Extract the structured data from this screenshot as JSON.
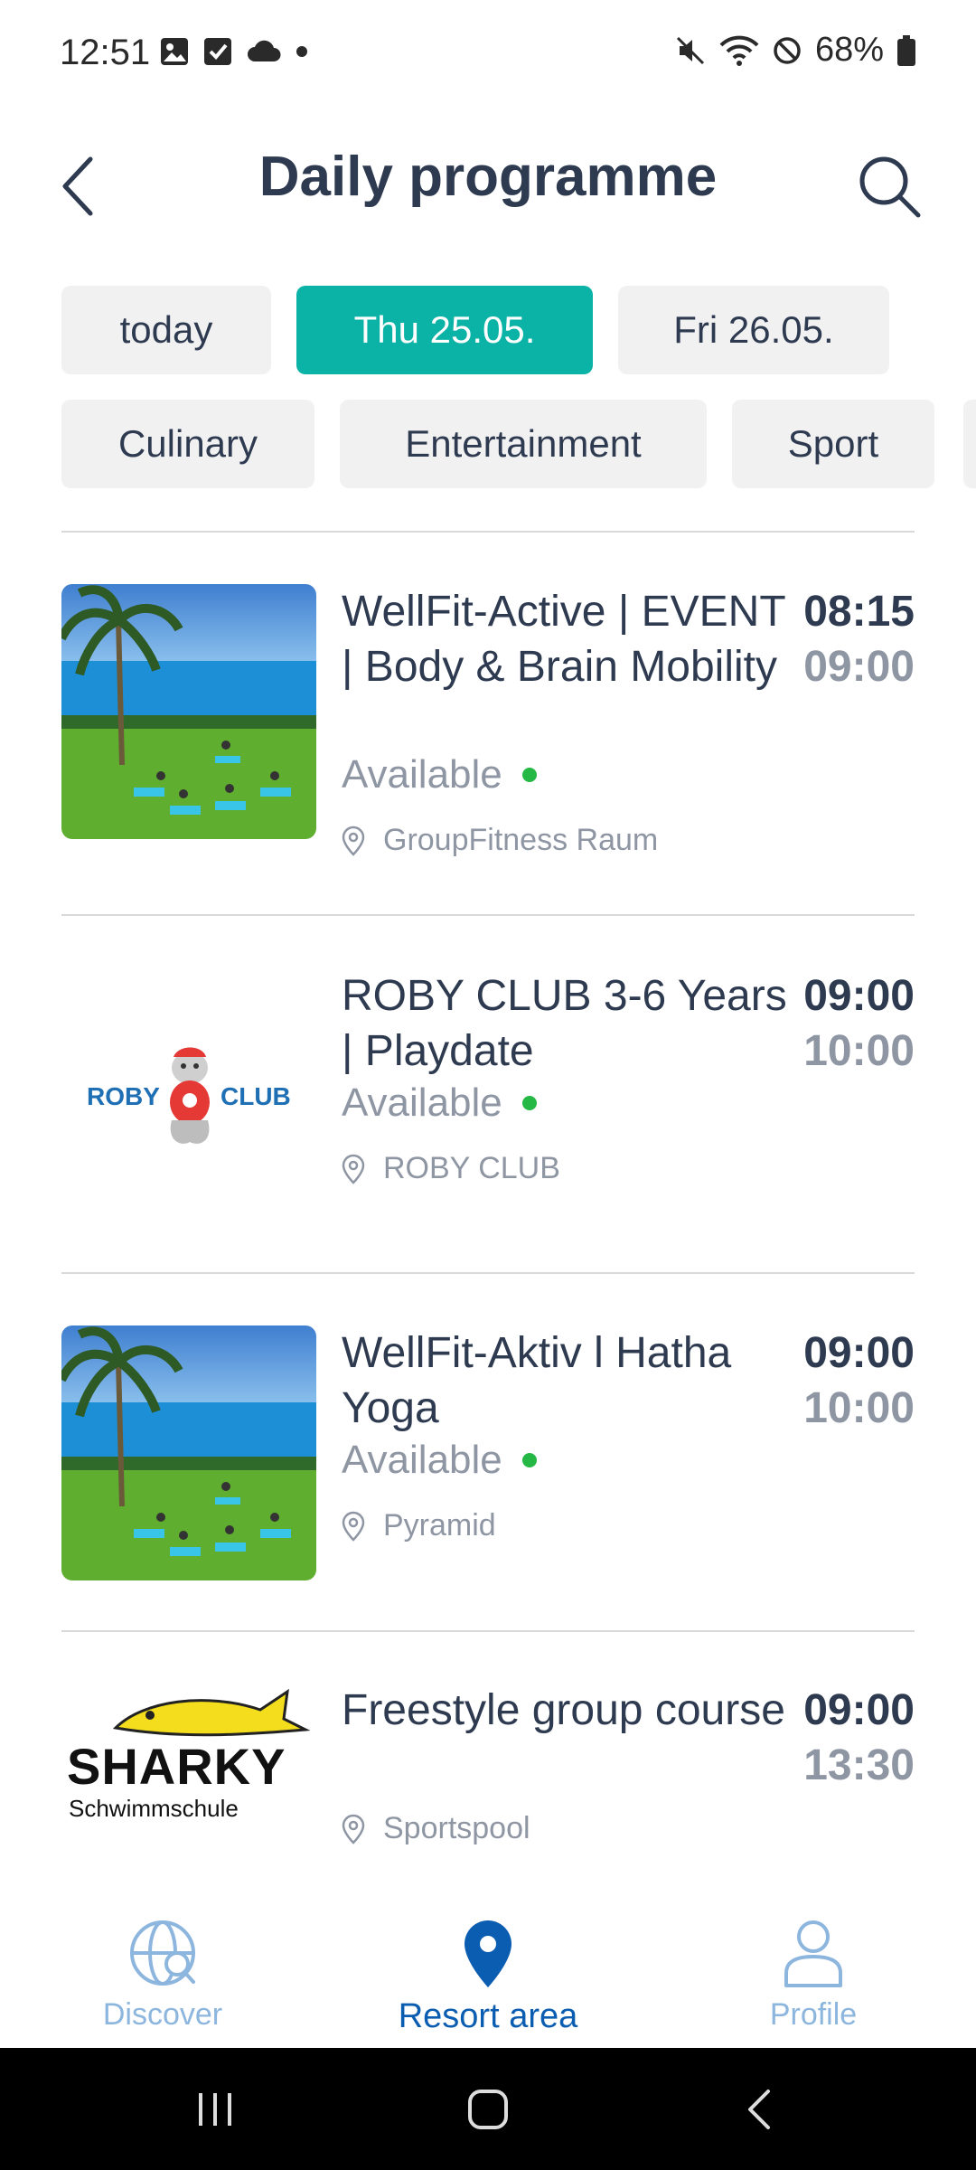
{
  "status_bar": {
    "time": "12:51",
    "battery": "68%",
    "icons": [
      "gallery-icon",
      "checkbox-icon",
      "cloud-icon",
      "dot-icon",
      "mute-icon",
      "wifi-icon",
      "dnd-icon",
      "battery-icon"
    ]
  },
  "header": {
    "title": "Daily programme",
    "back_icon": "chevron-left-icon",
    "search_icon": "search-icon"
  },
  "date_chips": [
    {
      "label": "today",
      "active": false
    },
    {
      "label": "Thu 25.05.",
      "active": true
    },
    {
      "label": "Fri 26.05.",
      "active": false
    }
  ],
  "category_chips": [
    {
      "label": "Culinary"
    },
    {
      "label": "Entertainment"
    },
    {
      "label": "Sport"
    }
  ],
  "events": [
    {
      "title": "WellFit-Active | EVENT | Body & Brain Mobility",
      "start": "08:15",
      "end": "09:00",
      "availability": "Available",
      "location": "GroupFitness Raum",
      "image": "yoga-photo"
    },
    {
      "title": "ROBY CLUB 3-6 Years | Playdate",
      "start": "09:00",
      "end": "10:00",
      "availability": "Available",
      "location": "ROBY CLUB",
      "image": "roby-club-logo",
      "logo_text_left": "ROBY",
      "logo_text_right": "CLUB"
    },
    {
      "title": "WellFit-Aktiv l Hatha Yoga",
      "start": "09:00",
      "end": "10:00",
      "availability": "Available",
      "location": "Pyramid",
      "image": "yoga-photo"
    },
    {
      "title": "Freestyle group course",
      "start": "09:00",
      "end": "13:30",
      "location": "Sportspool",
      "image": "sharky-logo",
      "logo_text_main": "SHARKY",
      "logo_text_sub": "Schwimmschule"
    }
  ],
  "bottom_nav": [
    {
      "label": "Discover",
      "icon": "globe-icon",
      "active": false
    },
    {
      "label": "Resort area",
      "icon": "location-pin-icon",
      "active": true
    },
    {
      "label": "Profile",
      "icon": "person-icon",
      "active": false
    }
  ],
  "colors": {
    "accent": "#0bb3a6",
    "nav_active": "#0a5db0",
    "nav_inactive": "#8db6de",
    "available_dot": "#25b844"
  }
}
